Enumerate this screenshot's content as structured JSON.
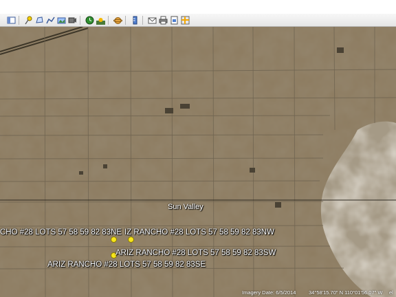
{
  "toolbar": {
    "buttons": [
      {
        "name": "sidebar-toggle",
        "icon": "sidebar-icon"
      },
      {
        "name": "add-placemark",
        "icon": "pushpin-icon"
      },
      {
        "name": "add-polygon",
        "icon": "polygon-icon"
      },
      {
        "name": "add-path",
        "icon": "path-icon"
      },
      {
        "name": "add-image-overlay",
        "icon": "image-overlay-icon"
      },
      {
        "name": "record-tour",
        "icon": "record-tour-icon"
      },
      {
        "name": "historical-imagery",
        "icon": "clock-icon"
      },
      {
        "name": "sunlight",
        "icon": "sun-icon"
      },
      {
        "name": "switch-planet",
        "icon": "planet-icon"
      },
      {
        "name": "ruler",
        "icon": "ruler-icon"
      },
      {
        "name": "email",
        "icon": "email-icon"
      },
      {
        "name": "print",
        "icon": "print-icon"
      },
      {
        "name": "save-image",
        "icon": "save-image-icon"
      },
      {
        "name": "view-in-maps",
        "icon": "maps-icon"
      }
    ]
  },
  "map": {
    "town_label": "Sun Valley",
    "placemarks": [
      {
        "id": "ne",
        "label_left": "CHO #28 LOTS 57 58 59 82 83NE",
        "label_right": "IZ RANCHO #28 LOTS 57 58 59 82 83NW"
      },
      {
        "id": "sw",
        "label": "ARIZ RANCHO #28 LOTS 57 58 59 82 83SW"
      },
      {
        "id": "se",
        "label": "ARIZ RANCHO #28 LOTS 57 58 59 82 83SE"
      }
    ]
  },
  "status_bar": {
    "imagery_date": "Imagery Date: 6/5/2014",
    "coordinates": "34°58'15.70\" N  110°01'56.07\" W",
    "elevation_partial": "el"
  },
  "colors": {
    "terrain": "#8e7d62",
    "playa": "#c9bfae",
    "road": "#6e6350",
    "placemark": "#f7e51a"
  }
}
